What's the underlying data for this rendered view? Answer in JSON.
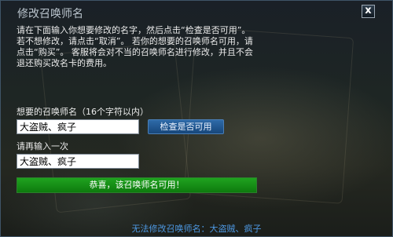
{
  "dialog": {
    "title": "修改召唤师名",
    "close_label": "x"
  },
  "instructions": {
    "lines": [
      "请在下面输入你想要修改的名字，然后点击“检查是否可用”。",
      "若不想修改，请点击“取消”。 若你的想要的召唤师名可用，请",
      "点击“购买”。 客服将会对不当的召唤师名进行修改，并且不会",
      "退还购买改名卡的费用。"
    ]
  },
  "form": {
    "name_label": "想要的召唤师名（16个字符以内）",
    "name_value": "大盗贼、疯子",
    "check_button_label": "检查是否可用",
    "confirm_label": "请再输入一次",
    "confirm_value": "大盗贼、疯子"
  },
  "status": {
    "message": "恭喜，该召唤师名可用！",
    "color": "#129012"
  },
  "footer": {
    "note": "无法修改召唤师名：大盗贼、疯子"
  }
}
